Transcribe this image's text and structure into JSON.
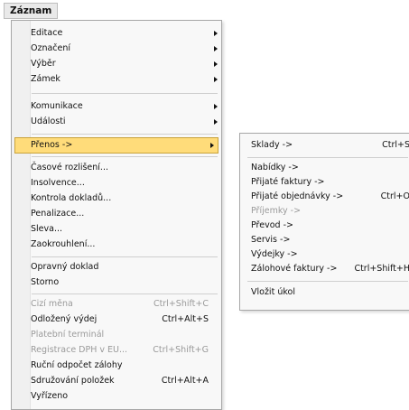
{
  "menubar": {
    "title": "Záznam"
  },
  "main_menu": {
    "items": [
      {
        "label": "Editace",
        "shortcut": "",
        "submenu": true,
        "disabled": false
      },
      {
        "label": "Označení",
        "shortcut": "",
        "submenu": true,
        "disabled": false
      },
      {
        "label": "Výběr",
        "shortcut": "",
        "submenu": true,
        "disabled": false
      },
      {
        "label": "Zámek",
        "shortcut": "",
        "submenu": true,
        "disabled": false
      },
      {
        "label": "Komunikace",
        "shortcut": "",
        "submenu": true,
        "disabled": false
      },
      {
        "label": "Události",
        "shortcut": "",
        "submenu": true,
        "disabled": false
      },
      {
        "label": "Přenos ->",
        "shortcut": "",
        "submenu": true,
        "disabled": false,
        "selected": true
      },
      {
        "label": "Časové rozlišení...",
        "shortcut": "",
        "submenu": false,
        "disabled": false
      },
      {
        "label": "Insolvence...",
        "shortcut": "",
        "submenu": false,
        "disabled": false
      },
      {
        "label": "Kontrola dokladů...",
        "shortcut": "",
        "submenu": false,
        "disabled": false
      },
      {
        "label": "Penalizace...",
        "shortcut": "",
        "submenu": false,
        "disabled": false
      },
      {
        "label": "Sleva...",
        "shortcut": "",
        "submenu": false,
        "disabled": false
      },
      {
        "label": "Zaokrouhlení...",
        "shortcut": "",
        "submenu": false,
        "disabled": false
      },
      {
        "label": "Opravný doklad",
        "shortcut": "",
        "submenu": false,
        "disabled": false
      },
      {
        "label": "Storno",
        "shortcut": "",
        "submenu": false,
        "disabled": false
      },
      {
        "label": "Cizí měna",
        "shortcut": "Ctrl+Shift+C",
        "submenu": false,
        "disabled": true
      },
      {
        "label": "Odložený výdej",
        "shortcut": "Ctrl+Alt+S",
        "submenu": false,
        "disabled": false
      },
      {
        "label": "Platební terminál",
        "shortcut": "",
        "submenu": false,
        "disabled": true
      },
      {
        "label": "Registrace DPH v EU...",
        "shortcut": "Ctrl+Shift+G",
        "submenu": false,
        "disabled": true
      },
      {
        "label": "Ruční odpočet zálohy",
        "shortcut": "",
        "submenu": false,
        "disabled": false
      },
      {
        "label": "Sdružování položek",
        "shortcut": "Ctrl+Alt+A",
        "submenu": false,
        "disabled": false
      },
      {
        "label": "Vyřízeno",
        "shortcut": "",
        "submenu": false,
        "disabled": false
      }
    ]
  },
  "sub_menu": {
    "items": [
      {
        "label": "Sklady ->",
        "shortcut": "Ctrl+S",
        "disabled": false
      },
      {
        "label": "Nabídky ->",
        "shortcut": "",
        "disabled": false
      },
      {
        "label": "Přijaté faktury ->",
        "shortcut": "",
        "disabled": false
      },
      {
        "label": "Přijaté objednávky ->",
        "shortcut": "Ctrl+O",
        "disabled": false
      },
      {
        "label": "Příjemky ->",
        "shortcut": "",
        "disabled": true
      },
      {
        "label": "Převod ->",
        "shortcut": "",
        "disabled": false
      },
      {
        "label": "Servis ->",
        "shortcut": "",
        "disabled": false
      },
      {
        "label": "Výdejky ->",
        "shortcut": "",
        "disabled": false
      },
      {
        "label": "Zálohové faktury ->",
        "shortcut": "Ctrl+Shift+H",
        "disabled": false
      },
      {
        "label": "Vložit úkol",
        "shortcut": "",
        "disabled": false
      }
    ]
  },
  "colors": {
    "highlight": "#ffdc7a",
    "highlight_border": "#c9a23a",
    "disabled": "#9a9a9a"
  }
}
